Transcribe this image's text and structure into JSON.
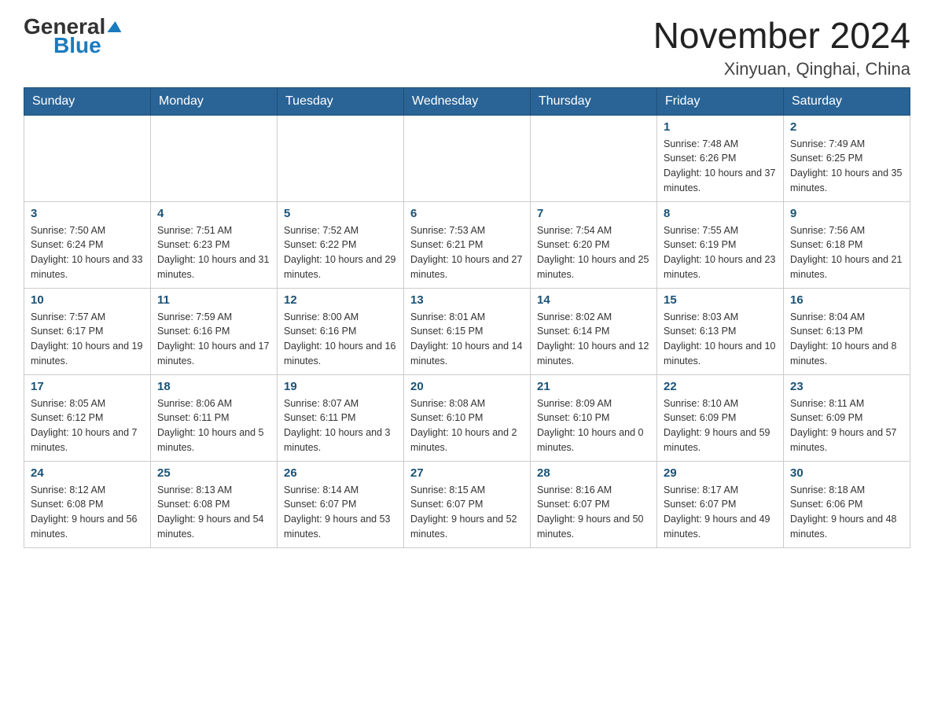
{
  "header": {
    "logo_general": "General",
    "logo_blue": "Blue",
    "month_year": "November 2024",
    "location": "Xinyuan, Qinghai, China"
  },
  "weekdays": [
    "Sunday",
    "Monday",
    "Tuesday",
    "Wednesday",
    "Thursday",
    "Friday",
    "Saturday"
  ],
  "weeks": [
    [
      {
        "day": "",
        "info": ""
      },
      {
        "day": "",
        "info": ""
      },
      {
        "day": "",
        "info": ""
      },
      {
        "day": "",
        "info": ""
      },
      {
        "day": "",
        "info": ""
      },
      {
        "day": "1",
        "info": "Sunrise: 7:48 AM\nSunset: 6:26 PM\nDaylight: 10 hours and 37 minutes."
      },
      {
        "day": "2",
        "info": "Sunrise: 7:49 AM\nSunset: 6:25 PM\nDaylight: 10 hours and 35 minutes."
      }
    ],
    [
      {
        "day": "3",
        "info": "Sunrise: 7:50 AM\nSunset: 6:24 PM\nDaylight: 10 hours and 33 minutes."
      },
      {
        "day": "4",
        "info": "Sunrise: 7:51 AM\nSunset: 6:23 PM\nDaylight: 10 hours and 31 minutes."
      },
      {
        "day": "5",
        "info": "Sunrise: 7:52 AM\nSunset: 6:22 PM\nDaylight: 10 hours and 29 minutes."
      },
      {
        "day": "6",
        "info": "Sunrise: 7:53 AM\nSunset: 6:21 PM\nDaylight: 10 hours and 27 minutes."
      },
      {
        "day": "7",
        "info": "Sunrise: 7:54 AM\nSunset: 6:20 PM\nDaylight: 10 hours and 25 minutes."
      },
      {
        "day": "8",
        "info": "Sunrise: 7:55 AM\nSunset: 6:19 PM\nDaylight: 10 hours and 23 minutes."
      },
      {
        "day": "9",
        "info": "Sunrise: 7:56 AM\nSunset: 6:18 PM\nDaylight: 10 hours and 21 minutes."
      }
    ],
    [
      {
        "day": "10",
        "info": "Sunrise: 7:57 AM\nSunset: 6:17 PM\nDaylight: 10 hours and 19 minutes."
      },
      {
        "day": "11",
        "info": "Sunrise: 7:59 AM\nSunset: 6:16 PM\nDaylight: 10 hours and 17 minutes."
      },
      {
        "day": "12",
        "info": "Sunrise: 8:00 AM\nSunset: 6:16 PM\nDaylight: 10 hours and 16 minutes."
      },
      {
        "day": "13",
        "info": "Sunrise: 8:01 AM\nSunset: 6:15 PM\nDaylight: 10 hours and 14 minutes."
      },
      {
        "day": "14",
        "info": "Sunrise: 8:02 AM\nSunset: 6:14 PM\nDaylight: 10 hours and 12 minutes."
      },
      {
        "day": "15",
        "info": "Sunrise: 8:03 AM\nSunset: 6:13 PM\nDaylight: 10 hours and 10 minutes."
      },
      {
        "day": "16",
        "info": "Sunrise: 8:04 AM\nSunset: 6:13 PM\nDaylight: 10 hours and 8 minutes."
      }
    ],
    [
      {
        "day": "17",
        "info": "Sunrise: 8:05 AM\nSunset: 6:12 PM\nDaylight: 10 hours and 7 minutes."
      },
      {
        "day": "18",
        "info": "Sunrise: 8:06 AM\nSunset: 6:11 PM\nDaylight: 10 hours and 5 minutes."
      },
      {
        "day": "19",
        "info": "Sunrise: 8:07 AM\nSunset: 6:11 PM\nDaylight: 10 hours and 3 minutes."
      },
      {
        "day": "20",
        "info": "Sunrise: 8:08 AM\nSunset: 6:10 PM\nDaylight: 10 hours and 2 minutes."
      },
      {
        "day": "21",
        "info": "Sunrise: 8:09 AM\nSunset: 6:10 PM\nDaylight: 10 hours and 0 minutes."
      },
      {
        "day": "22",
        "info": "Sunrise: 8:10 AM\nSunset: 6:09 PM\nDaylight: 9 hours and 59 minutes."
      },
      {
        "day": "23",
        "info": "Sunrise: 8:11 AM\nSunset: 6:09 PM\nDaylight: 9 hours and 57 minutes."
      }
    ],
    [
      {
        "day": "24",
        "info": "Sunrise: 8:12 AM\nSunset: 6:08 PM\nDaylight: 9 hours and 56 minutes."
      },
      {
        "day": "25",
        "info": "Sunrise: 8:13 AM\nSunset: 6:08 PM\nDaylight: 9 hours and 54 minutes."
      },
      {
        "day": "26",
        "info": "Sunrise: 8:14 AM\nSunset: 6:07 PM\nDaylight: 9 hours and 53 minutes."
      },
      {
        "day": "27",
        "info": "Sunrise: 8:15 AM\nSunset: 6:07 PM\nDaylight: 9 hours and 52 minutes."
      },
      {
        "day": "28",
        "info": "Sunrise: 8:16 AM\nSunset: 6:07 PM\nDaylight: 9 hours and 50 minutes."
      },
      {
        "day": "29",
        "info": "Sunrise: 8:17 AM\nSunset: 6:07 PM\nDaylight: 9 hours and 49 minutes."
      },
      {
        "day": "30",
        "info": "Sunrise: 8:18 AM\nSunset: 6:06 PM\nDaylight: 9 hours and 48 minutes."
      }
    ]
  ]
}
